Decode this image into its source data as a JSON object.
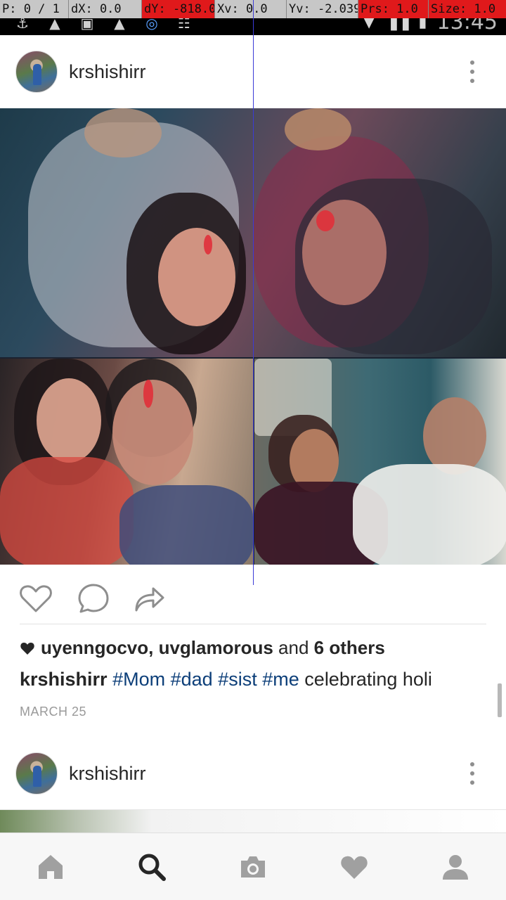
{
  "pointer_overlay": {
    "p": "P: 0 / 1",
    "dx": "dX: 0.0",
    "dy": "dY: -818.0",
    "xv": "Xv: 0.0",
    "yv": "Yv: -2.039",
    "prs": "Prs: 1.0",
    "size": "Size: 1.0"
  },
  "status_bar": {
    "time": "13:45",
    "icons": [
      "usb-icon",
      "notification-icon",
      "image-icon",
      "notification-icon",
      "camera-app-icon",
      "signal-bars-icon"
    ]
  },
  "post": {
    "username": "krshishirr",
    "likes": {
      "users": "uyenngocvo, uvglamorous",
      "and": " and ",
      "others": "6 others"
    },
    "caption": {
      "username": "krshishirr",
      "tags": [
        "#Mom",
        "#dad",
        "#sist",
        "#me"
      ],
      "text": "celebrating holi"
    },
    "date": "MARCH 25"
  },
  "next_post": {
    "username": "krshishirr"
  },
  "colors": {
    "hashtag": "#0d3f79",
    "icon_gray": "#8e8e8e",
    "nav_active": "#262626",
    "nav_inactive": "#a0a0a0"
  },
  "bottom_nav": [
    "home-icon",
    "search-icon",
    "camera-icon",
    "heart-icon",
    "profile-icon"
  ]
}
